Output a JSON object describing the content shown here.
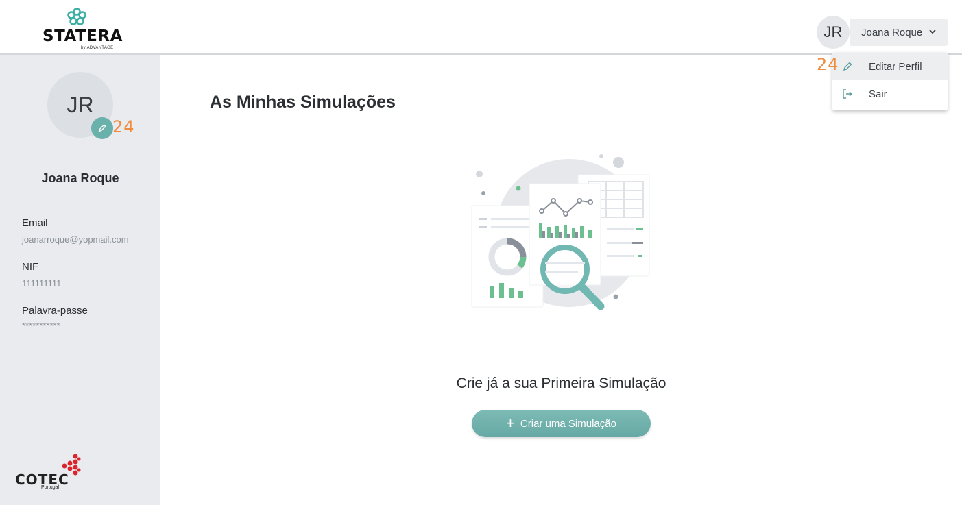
{
  "brand": {
    "name": "STATERA",
    "tagline": "by ADVANTAGE",
    "partner": "COTEC",
    "partner_sub": "Portugal"
  },
  "header": {
    "avatar_initials": "JR",
    "user_name": "Joana Roque",
    "badge": "24",
    "menu": [
      {
        "label": "Editar Perfil",
        "icon": "pencil-icon"
      },
      {
        "label": "Sair",
        "icon": "logout-icon"
      }
    ]
  },
  "sidebar": {
    "avatar_initials": "JR",
    "badge": "24",
    "name": "Joana Roque",
    "fields": [
      {
        "label": "Email",
        "value": "joanarroque@yopmail.com"
      },
      {
        "label": "NIF",
        "value": "111111111"
      },
      {
        "label": "Palavra-passe",
        "value": "***********"
      }
    ]
  },
  "main": {
    "title": "As Minhas Simulações",
    "empty_message": "Crie já a sua Primeira Simulação",
    "create_button": "Criar uma Simulação"
  },
  "colors": {
    "accent": "#6ab0ab",
    "badge": "#f08a3c",
    "sidebar_bg": "#e9ebee"
  }
}
